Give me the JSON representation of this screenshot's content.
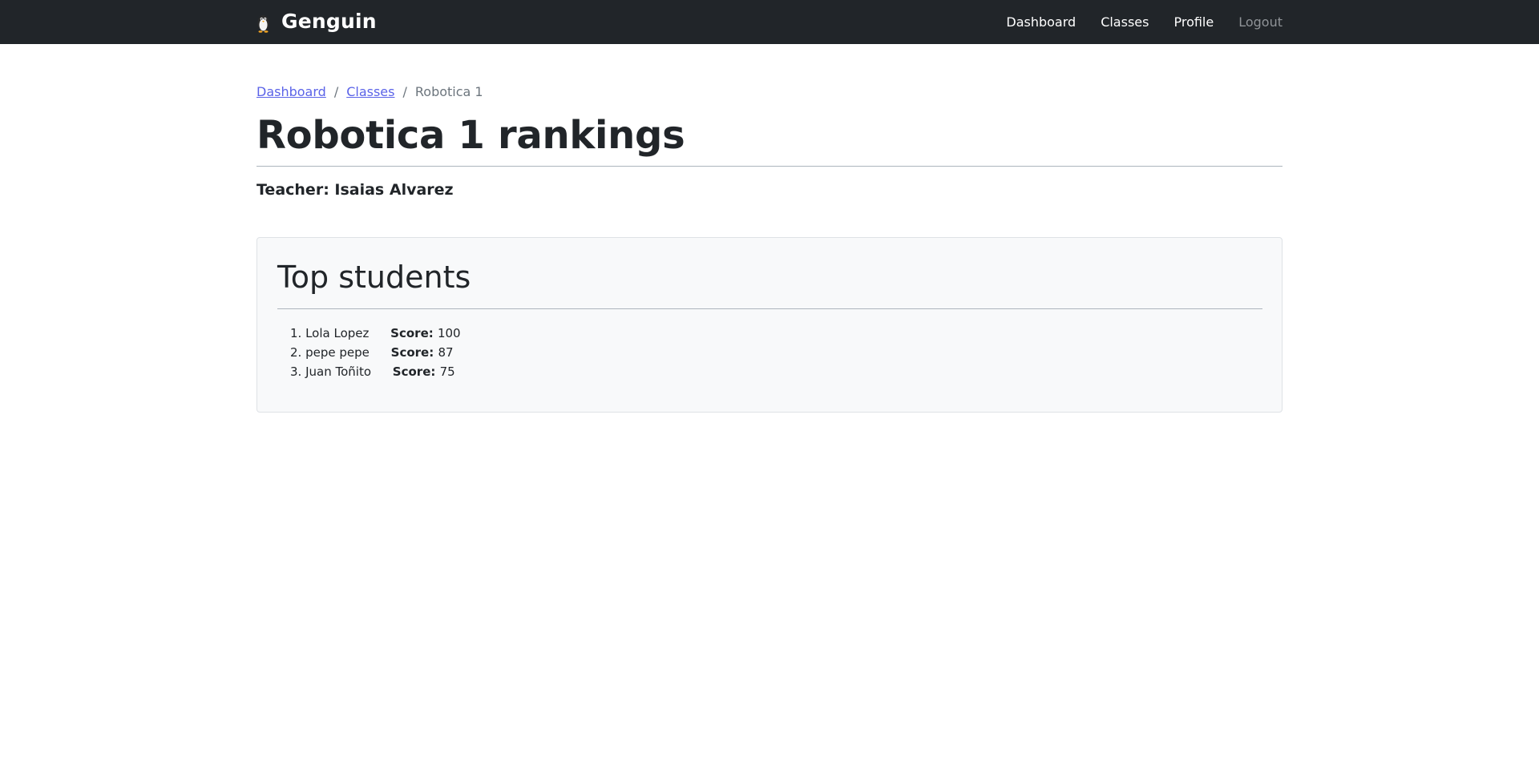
{
  "navbar": {
    "brand": "Genguin",
    "links": {
      "dashboard": "Dashboard",
      "classes": "Classes",
      "profile": "Profile",
      "logout": "Logout"
    }
  },
  "breadcrumb": {
    "dashboard": "Dashboard",
    "classes": "Classes",
    "current": "Robotica 1",
    "separator": "/"
  },
  "page": {
    "title": "Robotica 1 rankings",
    "teacher": "Teacher: Isaias Alvarez"
  },
  "ranking": {
    "heading": "Top students",
    "score_label": "Score:",
    "students": [
      {
        "rank": "1.",
        "name": "Lola Lopez",
        "score": "100"
      },
      {
        "rank": "2.",
        "name": "pepe pepe",
        "score": "87"
      },
      {
        "rank": "3.",
        "name": "Juan Toñito",
        "score": "75"
      }
    ]
  },
  "colors": {
    "navbar_bg": "#212529",
    "link": "#5b63e8",
    "muted": "#6c757d",
    "card_bg": "#f8f9fa"
  },
  "icons": {
    "brand_logo": "penguin-icon"
  }
}
